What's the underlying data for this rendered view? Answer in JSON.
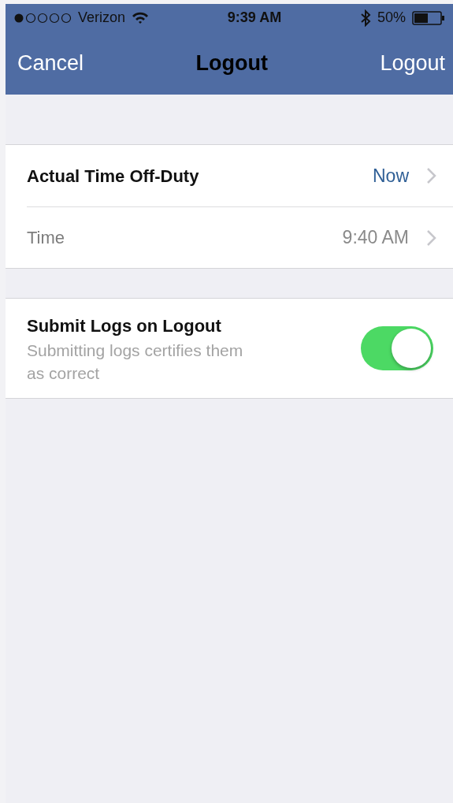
{
  "status_bar": {
    "carrier": "Verizon",
    "time": "9:39 AM",
    "battery": "50%"
  },
  "nav_bar": {
    "left_button": "Cancel",
    "title": "Logout",
    "right_button": "Logout"
  },
  "sections": [
    {
      "rows": [
        {
          "kind": "detail",
          "label": "Actual Time Off-Duty",
          "value": "Now",
          "disabled": false
        },
        {
          "kind": "detail",
          "label": "Time",
          "value": "9:40 AM",
          "disabled": true
        }
      ]
    },
    {
      "rows": [
        {
          "kind": "switch",
          "label": "Submit Logs on Logout",
          "subtitle": "Submitting logs certifies them as correct",
          "on": true
        }
      ]
    }
  ]
}
